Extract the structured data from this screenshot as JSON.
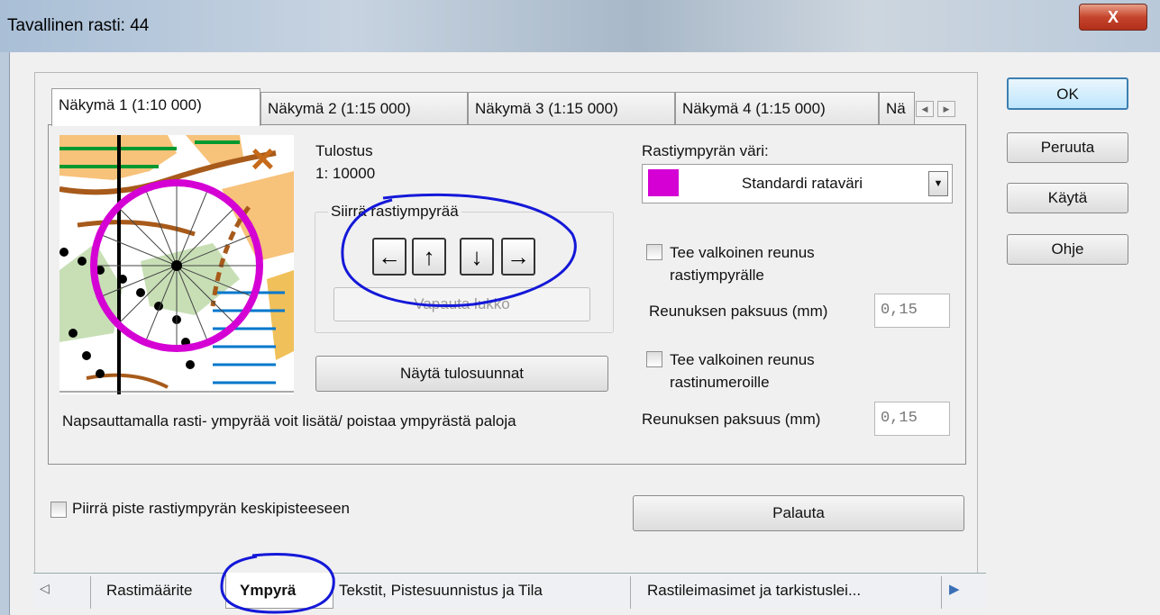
{
  "window": {
    "title": "Tavallinen rasti: 44",
    "close_label": "X"
  },
  "dialog_buttons": {
    "ok": "OK",
    "cancel": "Peruuta",
    "apply": "Käytä",
    "help": "Ohje"
  },
  "view_tabs": [
    "Näkymä 1  (1:10 000)",
    "Näkymä 2  (1:15 000)",
    "Näkymä 3  (1:15 000)",
    "Näkymä 4  (1:15 000)",
    "Nä"
  ],
  "print": {
    "label": "Tulostus",
    "scale": "1: 10000"
  },
  "move_group": {
    "label": "Siirrä rastiympyrää",
    "unlock_label": "Vapauta lukko",
    "arrows": [
      "←",
      "↑",
      "↓",
      "→"
    ]
  },
  "show_print_directions": "Näytä tulosuunnat",
  "hint_text": "Napsauttamalla rasti- ympyrää voit lisätä/ poistaa ympyrästä paloja",
  "circle_color": {
    "label": "Rastiympyrän väri:",
    "value": "Standardi rataväri",
    "swatch": "#d400d4"
  },
  "white_edge_circle": {
    "label_line1": "Tee valkoinen reunus",
    "label_line2": "rastiympyrälle",
    "thickness_label": "Reunuksen paksuus (mm)",
    "thickness_value": "0,15"
  },
  "white_edge_numbers": {
    "label_line1": "Tee valkoinen reunus",
    "label_line2": "rastinumeroille",
    "thickness_label": "Reunuksen paksuus (mm)",
    "thickness_value": "0,15"
  },
  "draw_center_point": "Piirrä piste rastiympyrän keskipisteeseen",
  "reset": "Palauta",
  "bottom_tabs": [
    "Rastimäärite",
    "Ympyrä",
    "Tekstit, Pistesuunnistus ja Tila",
    "Rastileimasimet ja tarkistuslei..."
  ],
  "annotation_color": "#1418d8"
}
